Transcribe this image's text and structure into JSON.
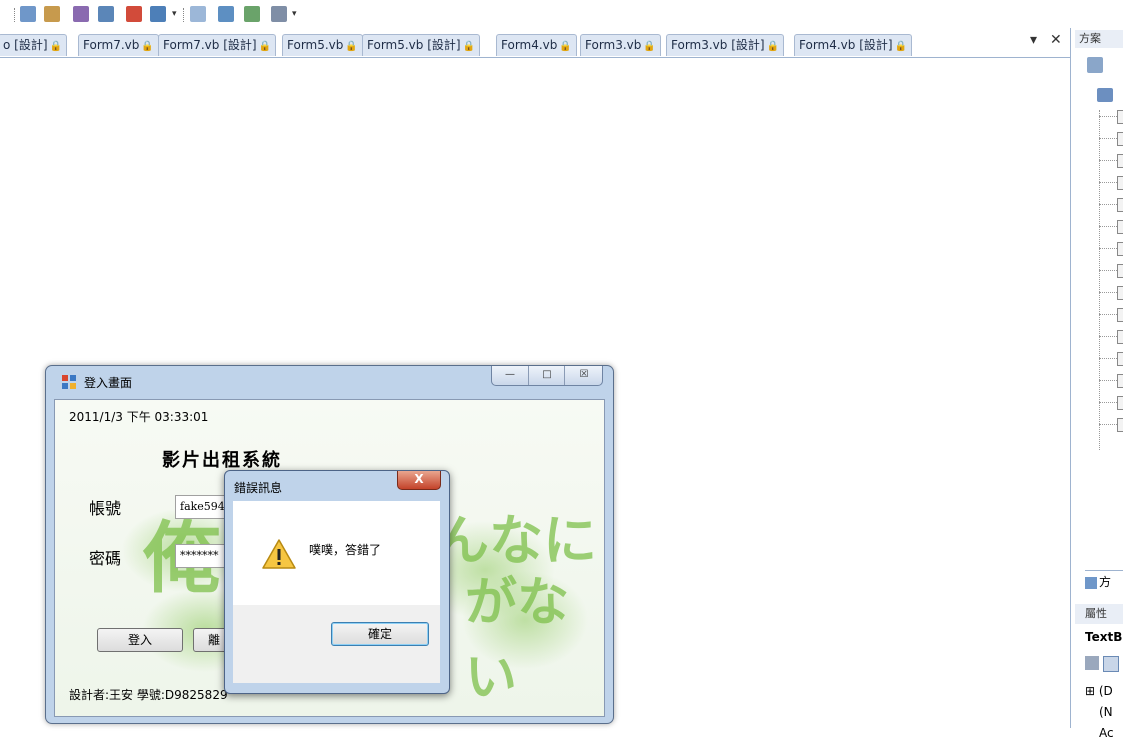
{
  "toolbar": {
    "icons": [
      "class-view-icon",
      "properties-icon",
      "object-browser-icon",
      "tools-icon",
      "error-list-icon",
      "output-icon",
      "find-icon",
      "layout-icon",
      "format-icon",
      "order-icon"
    ]
  },
  "tabs": [
    {
      "label": "o [設計]",
      "lock": "🔒"
    },
    {
      "label": "Form7.vb",
      "lock": "🔒"
    },
    {
      "label": "Form7.vb [設計]",
      "lock": "🔒"
    },
    {
      "label": "Form5.vb",
      "lock": "🔒"
    },
    {
      "label": "Form5.vb [設計]",
      "lock": "🔒"
    },
    {
      "label": "Form4.vb",
      "lock": "🔒"
    },
    {
      "label": "Form3.vb",
      "lock": "🔒"
    },
    {
      "label": "Form3.vb [設計]",
      "lock": "🔒"
    },
    {
      "label": "Form4.vb [設計]",
      "lock": "🔒"
    }
  ],
  "tab_controls": {
    "dropdown": "▾",
    "close": "✕"
  },
  "solution_panel": {
    "title": "方案",
    "bottom_tab": "方"
  },
  "properties_panel": {
    "title": "屬性",
    "object": "TextB",
    "rows": [
      "⊞ (D",
      "(N",
      "Ac"
    ]
  },
  "login_window": {
    "title": "登入畫面",
    "minimize": "—",
    "maximize": "□",
    "close": "☒",
    "datetime": "2011/1/3 下午 03:33:01",
    "app_title": "影片出租系統",
    "account_label": "帳號",
    "account_value": "fake594",
    "password_label": "密碼",
    "password_value": "*******",
    "login_button": "登入",
    "second_button": "離",
    "credit": "設計者:王安 學號:D9825829",
    "deco": [
      "俺",
      "んなに",
      "がない"
    ]
  },
  "error_dialog": {
    "title": "錯誤訊息",
    "close": "X",
    "message": "噗噗，答錯了",
    "ok_button": "確定"
  }
}
